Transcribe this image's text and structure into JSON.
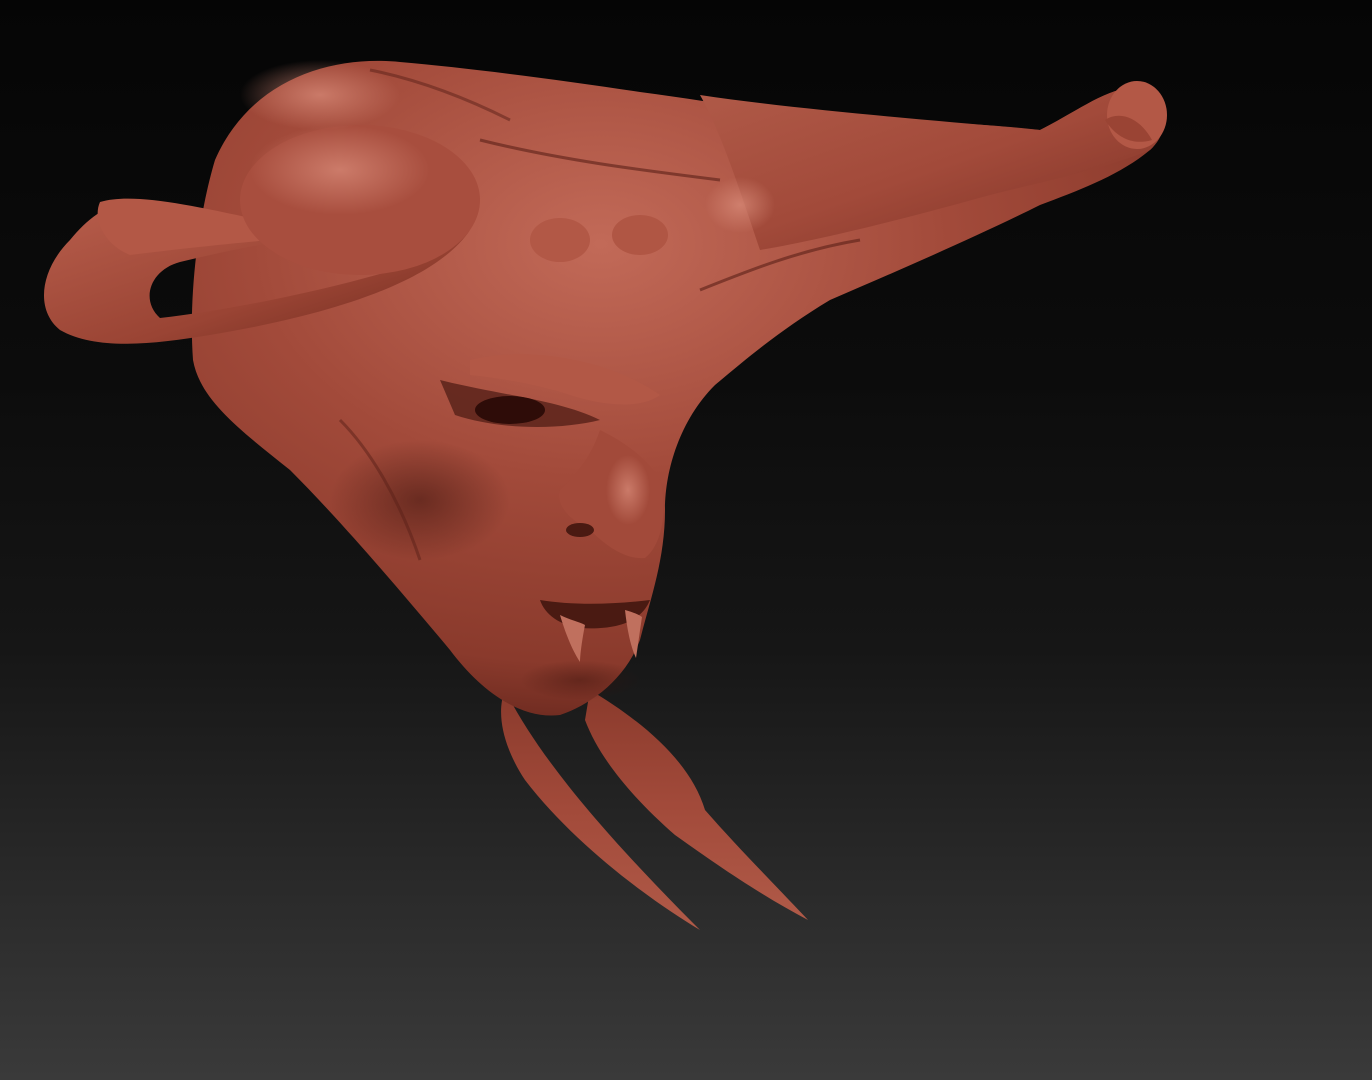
{
  "scene": {
    "subject": "sculpted-demon-head",
    "colors": {
      "background_top": "#050505",
      "background_mid": "#161616",
      "background_bottom": "#3a3a3a",
      "clay_light": "#c26a58",
      "clay_base": "#a24a3a",
      "clay_mid": "#8a3a2c",
      "clay_dark": "#5a2018",
      "clay_shadow": "#3a120c"
    }
  }
}
